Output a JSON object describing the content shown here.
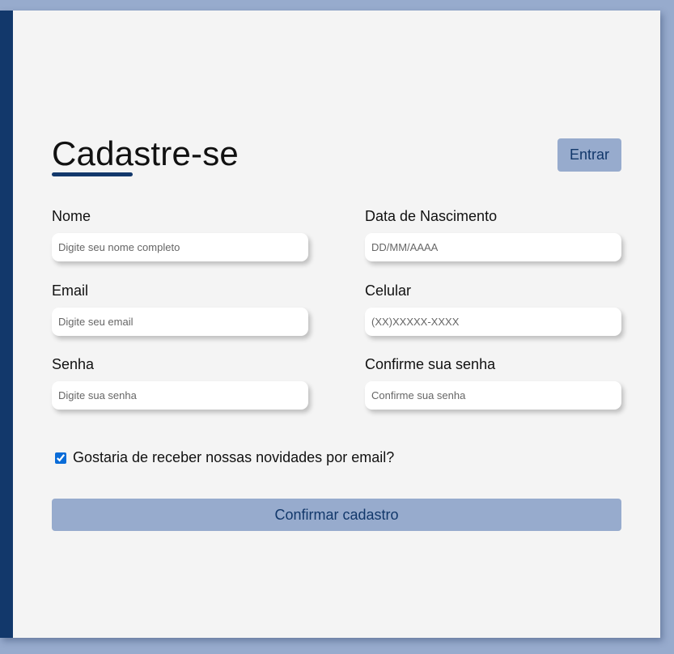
{
  "header": {
    "title": "Cadastre-se",
    "login_label": "Entrar"
  },
  "fields": {
    "name": {
      "label": "Nome",
      "placeholder": "Digite seu nome completo",
      "value": ""
    },
    "birthdate": {
      "label": "Data de Nascimento",
      "placeholder": "DD/MM/AAAA",
      "value": ""
    },
    "email": {
      "label": "Email",
      "placeholder": "Digite seu email",
      "value": ""
    },
    "phone": {
      "label": "Celular",
      "placeholder": "(XX)XXXXX-XXXX",
      "value": ""
    },
    "password": {
      "label": "Senha",
      "placeholder": "Digite sua senha",
      "value": ""
    },
    "confirm_password": {
      "label": "Confirme sua senha",
      "placeholder": "Confirme sua senha",
      "value": ""
    }
  },
  "newsletter": {
    "label": "Gostaria de receber nossas novidades por email?",
    "checked": true
  },
  "submit": {
    "label": "Confirmar cadastro"
  },
  "colors": {
    "background": "#97abcd",
    "card": "#f4f4f4",
    "accent_dark": "#12386b",
    "button": "#97abcd"
  }
}
